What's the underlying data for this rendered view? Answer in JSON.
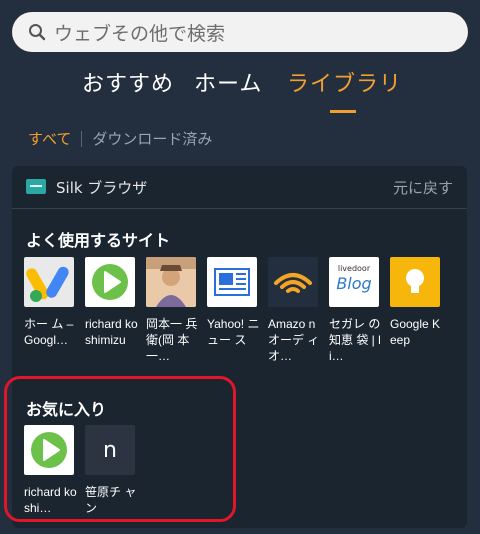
{
  "search": {
    "placeholder": "ウェブその他で検索"
  },
  "tabs": [
    {
      "label": "おすすめ"
    },
    {
      "label": "ホーム"
    },
    {
      "label": "ライブラリ"
    }
  ],
  "subtabs": {
    "all": "すべて",
    "downloaded": "ダウンロード済み"
  },
  "app": {
    "name": "Silk ブラウザ",
    "back_label": "元に戻す"
  },
  "frequent": {
    "title": "よく使用するサイト",
    "sites": [
      {
        "label": "ホー ム – Googl…",
        "icon": "google-ads-icon"
      },
      {
        "label": "richard koshimizu",
        "icon": "play-icon"
      },
      {
        "label": "岡本一 兵衛(岡 本一…",
        "icon": "portrait-icon"
      },
      {
        "label": "Yahoo! ニュー ス",
        "icon": "newspaper-icon"
      },
      {
        "label": "Amazo nオーデ ィオ…",
        "icon": "audible-icon"
      },
      {
        "label": "セガレ の知恵 袋 | li…",
        "icon": "livedoor-blog-icon"
      },
      {
        "label": "Google Keep",
        "icon": "google-keep-icon"
      }
    ]
  },
  "favorites": {
    "title": "お気に入り",
    "sites": [
      {
        "label": "richard koshi…",
        "icon": "play-icon"
      },
      {
        "label": "笹原チ ャン",
        "icon": "letter-n-icon",
        "letter": "n"
      }
    ]
  },
  "blog_tile": {
    "top": "livedoor",
    "main": "Blog"
  },
  "colors": {
    "accent": "#f0a030",
    "background": "#232f3e",
    "panel": "#1b2530",
    "highlight_ring": "#e0162b"
  }
}
